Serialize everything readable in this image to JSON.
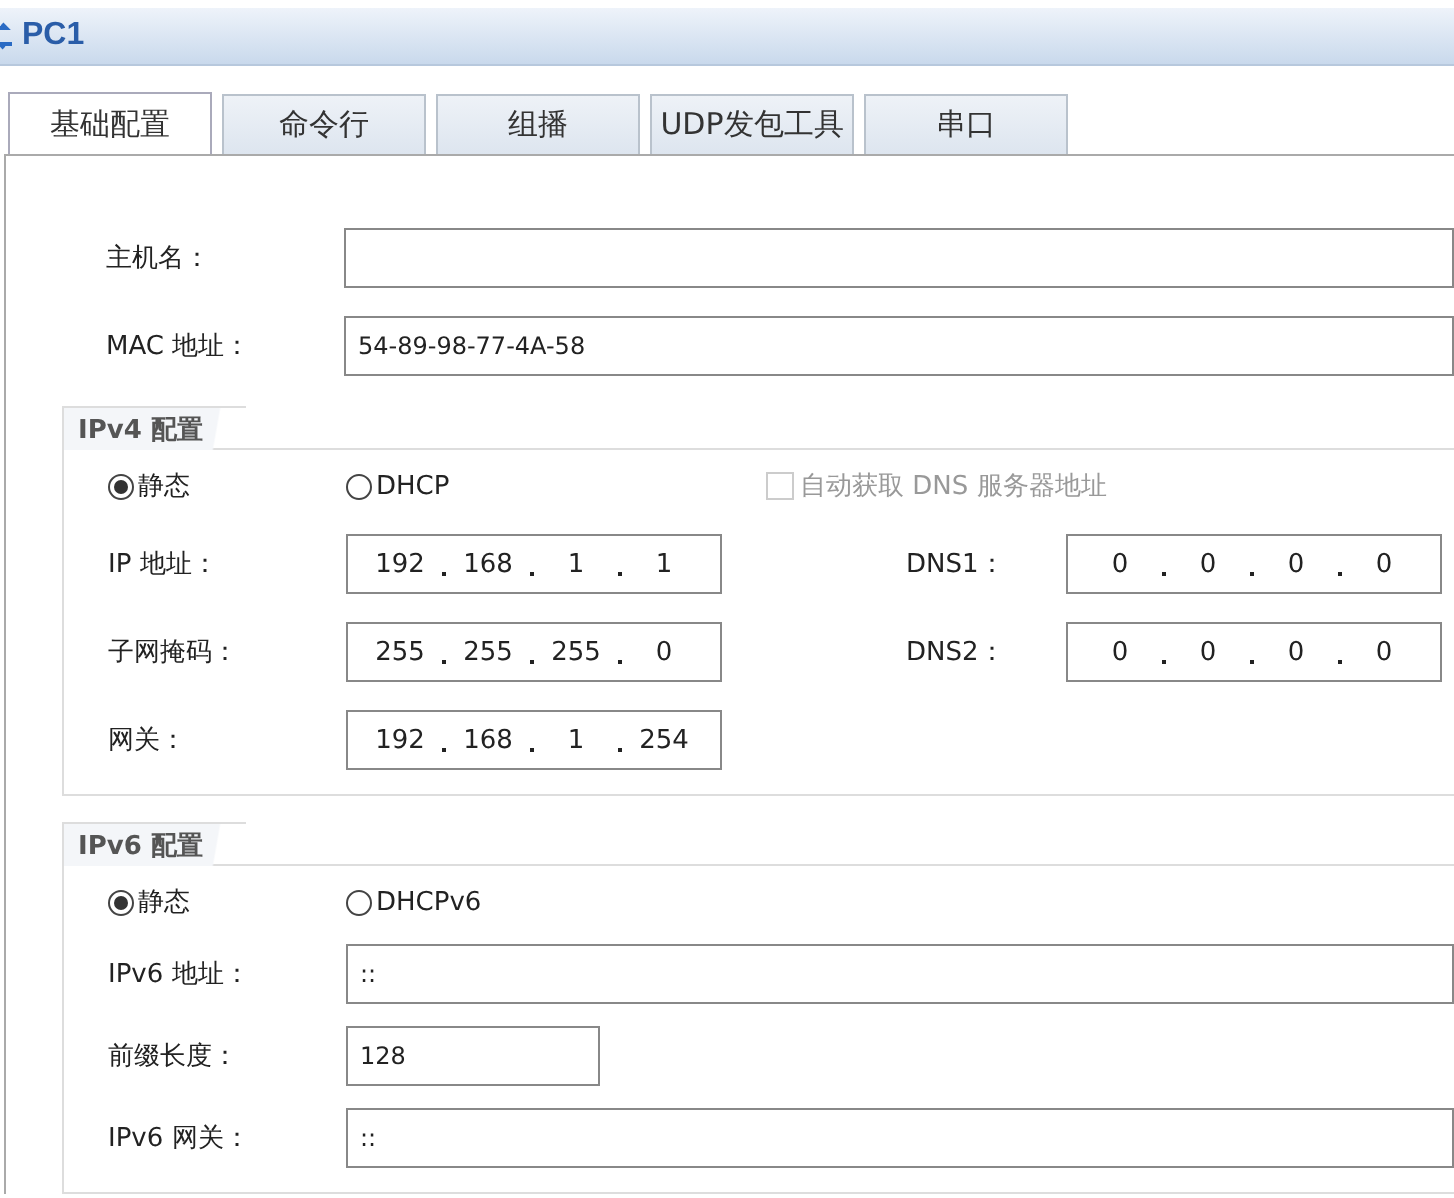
{
  "window": {
    "title": "PC1"
  },
  "tabs": [
    {
      "label": "基础配置",
      "selected": true
    },
    {
      "label": "命令行",
      "selected": false
    },
    {
      "label": "组播",
      "selected": false
    },
    {
      "label": "UDP发包工具",
      "selected": false
    },
    {
      "label": "串口",
      "selected": false
    }
  ],
  "host": [
    {
      "label": "主机名："
    },
    {
      "label": "MAC 地址：",
      "value": "54-89-98-77-4A-58"
    }
  ],
  "ipv4": {
    "legend": "IPv4 配置",
    "modes": [
      {
        "label": "静态",
        "selected": true
      },
      {
        "label": "DHCP",
        "selected": false
      }
    ],
    "auto_dns": {
      "label": "自动获取 DNS 服务器地址",
      "checked": false,
      "disabled": true
    },
    "fields": [
      {
        "label": "IP 地址：",
        "octets": [
          "192",
          "168",
          "1",
          "1"
        ]
      },
      {
        "label": "子网掩码：",
        "octets": [
          "255",
          "255",
          "255",
          "0"
        ]
      },
      {
        "label": "网关：",
        "octets": [
          "192",
          "168",
          "1",
          "254"
        ]
      }
    ],
    "dns": [
      {
        "label": "DNS1：",
        "octets": [
          "0",
          "0",
          "0",
          "0"
        ]
      },
      {
        "label": "DNS2：",
        "octets": [
          "0",
          "0",
          "0",
          "0"
        ]
      }
    ]
  },
  "ipv6": {
    "legend": "IPv6 配置",
    "modes": [
      {
        "label": "静态",
        "selected": true
      },
      {
        "label": "DHCPv6",
        "selected": false
      }
    ],
    "fields": [
      {
        "label": "IPv6 地址：",
        "value": "::",
        "kind": "wide"
      },
      {
        "label": "前缀长度：",
        "value": "128",
        "kind": "short"
      },
      {
        "label": "IPv6 网关：",
        "value": "::",
        "kind": "wide"
      }
    ]
  }
}
